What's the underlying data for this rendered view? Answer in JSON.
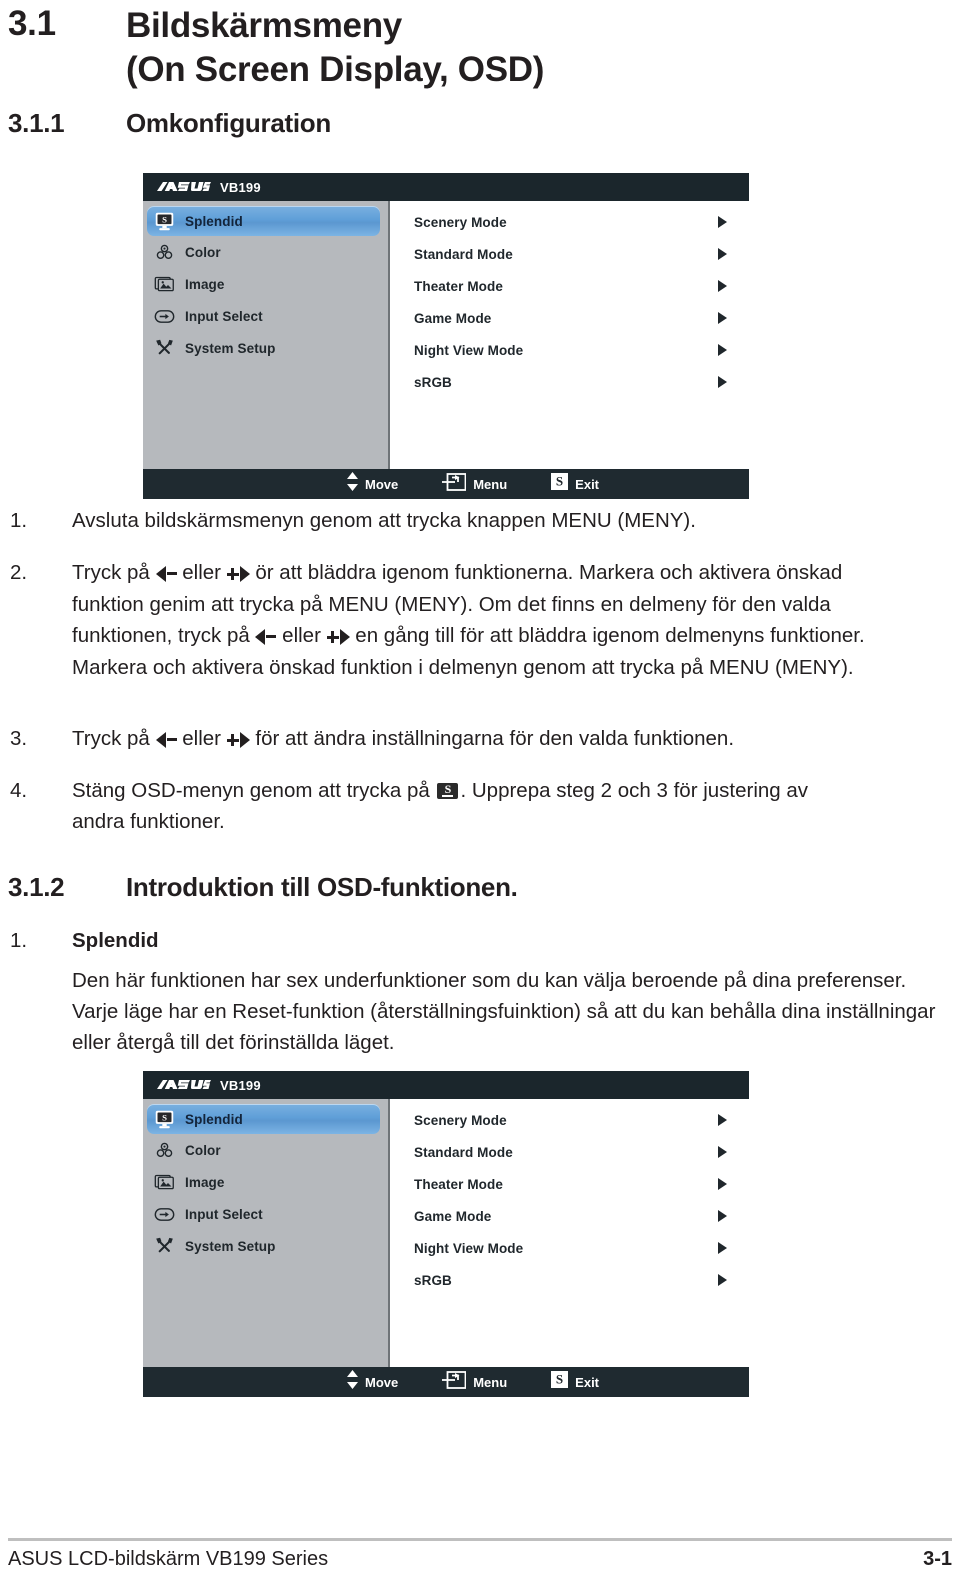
{
  "sections": {
    "s31": {
      "number": "3.1",
      "title_line1": "Bildskärmsmeny",
      "title_line2": "(On Screen Display, OSD)"
    },
    "s311": {
      "number": "3.1.1",
      "title": "Omkonfiguration"
    },
    "s312": {
      "number": "3.1.2",
      "title": "Introduktion till OSD-funktionen."
    }
  },
  "osd": {
    "brand": "ASUS",
    "model": "VB199",
    "sidebar": [
      {
        "label": "Splendid",
        "icon": "splendid-monitor-icon",
        "selected": true
      },
      {
        "label": "Color",
        "icon": "color-palette-icon",
        "selected": false
      },
      {
        "label": "Image",
        "icon": "image-picture-icon",
        "selected": false
      },
      {
        "label": "Input Select",
        "icon": "input-arrow-icon",
        "selected": false
      },
      {
        "label": "System Setup",
        "icon": "tools-wrench-screwdriver-icon",
        "selected": false
      }
    ],
    "items": [
      {
        "label": "Scenery Mode"
      },
      {
        "label": "Standard Mode"
      },
      {
        "label": "Theater Mode"
      },
      {
        "label": "Game Mode"
      },
      {
        "label": "Night View Mode"
      },
      {
        "label": "sRGB"
      }
    ],
    "footer": [
      {
        "label": "Move",
        "icon": "up-down-arrows-icon"
      },
      {
        "label": "Menu",
        "icon": "menu-enter-icon"
      },
      {
        "label": "Exit",
        "icon": "splendid-s-icon"
      }
    ],
    "colors": {
      "chrome": "#1f2a30",
      "titlebar": "#1b262c",
      "sidebar_bg": "#b6b9bd",
      "highlight": "#5f9fd8",
      "panel_bg": "#ffffff",
      "text": "#20272c"
    }
  },
  "steps": {
    "s1_num": "1.",
    "s1_text": "Avsluta bildskärmsmenyn genom att trycka knappen MENU (MENY).",
    "s2_num": "2.",
    "s2_a": "Tryck på ",
    "s2_b": " eller ",
    "s2_c": " ör att bläddra igenom funktionerna. Markera och aktivera  önskad funktion genim att trycka på MENU (MENY). Om det finns en delmeny för den valda funktionen, tryck på ",
    "s2_d": " eller ",
    "s2_e": " en gång till för att bläddra igenom delmenyns funktioner. Markera och aktivera  önskad funktion i delmenyn genom att trycka på MENU (MENY).",
    "s3_num": "3.",
    "s3_a": "Tryck på ",
    "s3_b": " eller ",
    "s3_c": " för att ändra inställningarna för den valda funktionen.",
    "s4_num": "4.",
    "s4_a": "Stäng OSD-menyn genom att trycka på ",
    "s4_b": ". Upprepa steg 2 och 3 för justering av andra funktioner."
  },
  "splendid": {
    "num": "1.",
    "heading": "Splendid",
    "body": "Den här funktionen har sex underfunktioner som du kan välja beroende på dina preferenser. Varje läge har en Reset-funktion (återställningsfuinktion) så att du kan behålla dina inställningar eller återgå till det förinställda läget."
  },
  "page_footer": {
    "left": "ASUS LCD-bildskärm VB199 Series",
    "right": "3-1"
  }
}
